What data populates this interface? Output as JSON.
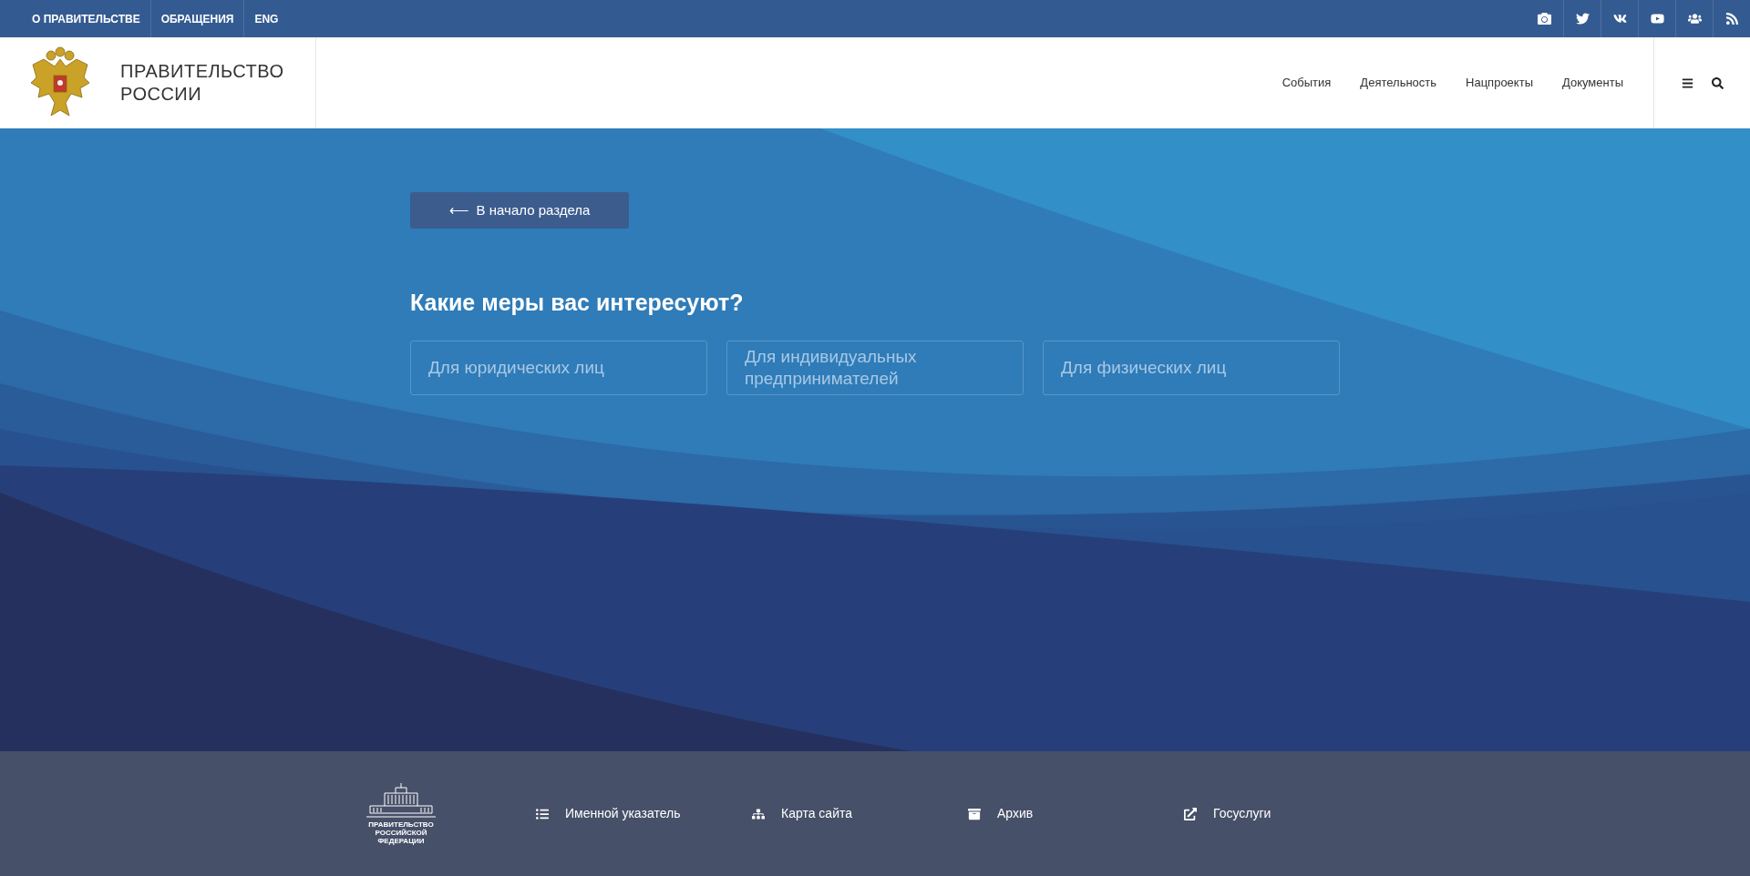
{
  "top_bar": {
    "links": [
      "О ПРАВИТЕЛЬСТВЕ",
      "ОБРАЩЕНИЯ",
      "ENG"
    ],
    "social": [
      {
        "kind": "camera"
      },
      {
        "kind": "twitter"
      },
      {
        "kind": "vk"
      },
      {
        "kind": "youtube"
      },
      {
        "kind": "users"
      },
      {
        "kind": "rss"
      }
    ]
  },
  "header": {
    "title_lines": [
      "ПРАВИТЕЛЬСТВО",
      "РОССИИ"
    ],
    "nav": [
      "События",
      "Деятельность",
      "Нацпроекты",
      "Документы"
    ]
  },
  "hero": {
    "back_button": "В начало раздела",
    "back_arrow": "⟵",
    "heading": "Какие меры вас интересуют?",
    "options": [
      "Для юридических лиц",
      "Для индивидуальных предпринимателей",
      "Для физических лиц"
    ]
  },
  "footer": {
    "logo_lines": [
      "ПРАВИТЕЛЬСТВО",
      "РОССИЙСКОЙ",
      "ФЕДЕРАЦИИ"
    ],
    "links": [
      {
        "kind": "list",
        "label": "Именной указатель"
      },
      {
        "kind": "sitemap",
        "label": "Карта сайта"
      },
      {
        "kind": "archive",
        "label": "Архив"
      },
      {
        "kind": "external",
        "label": "Госуслуги"
      }
    ]
  }
}
